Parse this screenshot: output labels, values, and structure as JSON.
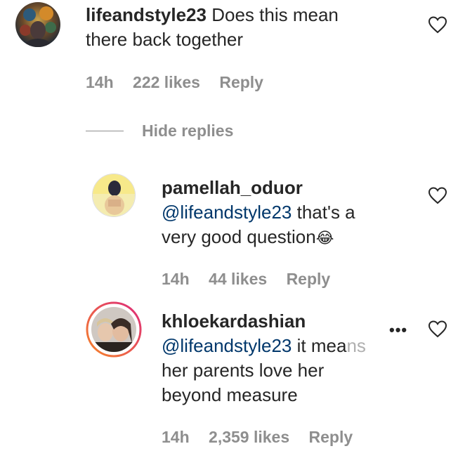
{
  "comments": [
    {
      "username": "lifeandstyle23",
      "text": "Does this mean",
      "text2": "there back together",
      "time": "14h",
      "likes": "222 likes",
      "reply": "Reply"
    },
    {
      "username": "pamellah_oduor",
      "mention": "@lifeandstyle23",
      "text": "that's a",
      "text2": "very good question",
      "emoji": "😂",
      "time": "14h",
      "likes": "44 likes",
      "reply": "Reply"
    },
    {
      "username": "khloekardashian",
      "mention": "@lifeandstyle23",
      "text": "it mea",
      "text_faded": "ns",
      "text2": "her parents love her",
      "text3": "beyond measure",
      "time": "14h",
      "likes": "2,359 likes",
      "reply": "Reply"
    }
  ],
  "hide_replies": "Hide replies",
  "more_glyph": "•••",
  "colors": {
    "text": "#262626",
    "meta": "#8e8e8e",
    "mention": "#00376b",
    "story_ring_start": "#f58529",
    "story_ring_end": "#dd2a7b"
  }
}
